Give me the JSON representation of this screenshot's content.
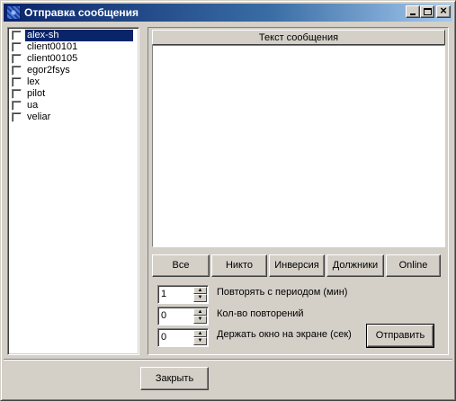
{
  "window": {
    "title": "Отправка сообщения",
    "icon": "app-icon"
  },
  "clients": [
    {
      "name": "alex-sh",
      "checked": false,
      "selected": true
    },
    {
      "name": "client00101",
      "checked": false,
      "selected": false
    },
    {
      "name": "client00105",
      "checked": false,
      "selected": false
    },
    {
      "name": "egor2fsys",
      "checked": false,
      "selected": false
    },
    {
      "name": "lex",
      "checked": false,
      "selected": false
    },
    {
      "name": "pilot",
      "checked": false,
      "selected": false
    },
    {
      "name": "ua",
      "checked": false,
      "selected": false
    },
    {
      "name": "veliar",
      "checked": false,
      "selected": false
    }
  ],
  "message": {
    "header": "Текст сообщения",
    "text": ""
  },
  "selection_buttons": {
    "all": "Все",
    "none": "Никто",
    "invert": "Инверсия",
    "debtors": "Должники",
    "online": "Online"
  },
  "options": {
    "repeat_period": {
      "value": "1",
      "label": "Повторять с периодом (мин)"
    },
    "repeat_count": {
      "value": "0",
      "label": "Кол-во повторений"
    },
    "keep_on_screen": {
      "value": "0",
      "label": "Держать окно на экране (сек)"
    }
  },
  "actions": {
    "send": "Отправить",
    "close": "Закрыть"
  },
  "colors": {
    "titlebar_start": "#0a246a",
    "titlebar_end": "#a6caf0",
    "face": "#d4d0c8",
    "selection": "#0a246a"
  }
}
